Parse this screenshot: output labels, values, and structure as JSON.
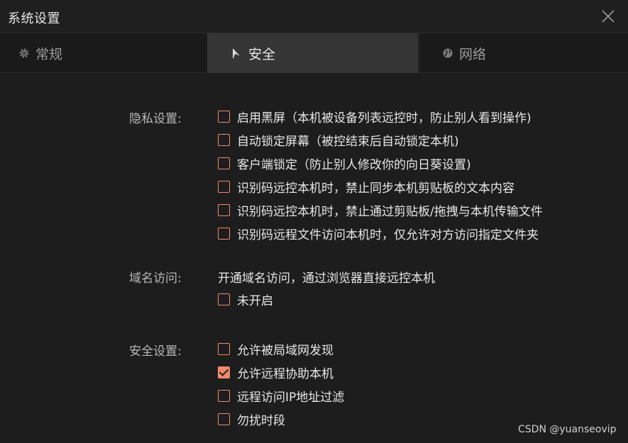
{
  "window": {
    "title": "系统设置"
  },
  "tabs": [
    {
      "label": "常规",
      "icon": "gear-icon"
    },
    {
      "label": "安全",
      "icon": "shield-flag-icon",
      "active": true
    },
    {
      "label": "网络",
      "icon": "globe-icon"
    }
  ],
  "privacy": {
    "label": "隐私设置:",
    "options": [
      {
        "text": "启用黑屏（本机被设备列表远控时，防止别人看到操作)",
        "checked": false
      },
      {
        "text": "自动锁定屏幕（被控结束后自动锁定本机)",
        "checked": false
      },
      {
        "text": "客户端锁定（防止别人修改你的向日葵设置)",
        "checked": false
      },
      {
        "text": "识别码远控本机时，禁止同步本机剪贴板的文本内容",
        "checked": false
      },
      {
        "text": "识别码远控本机时，禁止通过剪贴板/拖拽与本机传输文件",
        "checked": false
      },
      {
        "text": "识别码远程文件访问本机时，仅允许对方访问指定文件夹",
        "checked": false
      }
    ]
  },
  "domain": {
    "label": "域名访问:",
    "description": "开通域名访问，通过浏览器直接远控本机",
    "options": [
      {
        "text": "未开启",
        "checked": false
      }
    ]
  },
  "security": {
    "label": "安全设置:",
    "options": [
      {
        "text": "允许被局域网发现",
        "checked": false
      },
      {
        "text": "允许远程协助本机",
        "checked": true
      },
      {
        "text": "远程访问IP地址过滤",
        "checked": false
      },
      {
        "text": "勿扰时段",
        "checked": false
      }
    ]
  },
  "watermark": "CSDN @yuanseovip",
  "colors": {
    "accent": "#f08a68",
    "background": "#1d1d1d",
    "active_tab": "#353535"
  }
}
